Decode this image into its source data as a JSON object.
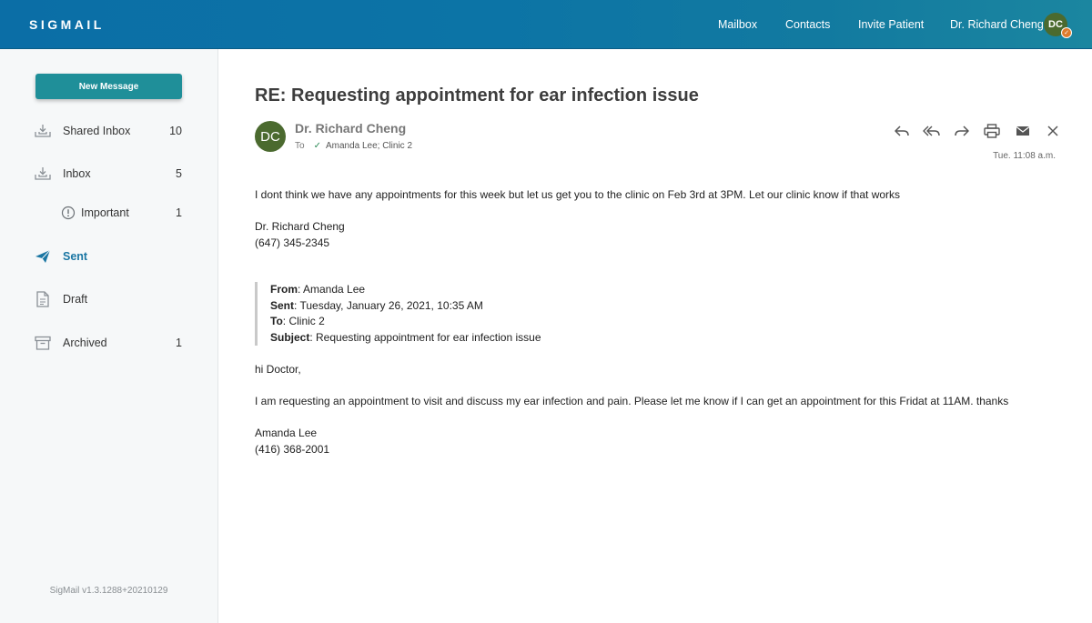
{
  "app": {
    "logo": "SIGMAIL",
    "nav": {
      "mailbox": "Mailbox",
      "contacts": "Contacts",
      "invite": "Invite Patient",
      "user": "Dr. Richard Cheng"
    },
    "avatar_initials": "DC",
    "brand_color": "#0c74a6",
    "accent_color": "#1f8f99"
  },
  "sidebar": {
    "new_message": "New Message",
    "items": [
      {
        "label": "Shared Inbox",
        "count": "10",
        "icon": "inbox-download-icon"
      },
      {
        "label": "Inbox",
        "count": "5",
        "icon": "inbox-download-icon"
      },
      {
        "label": "Important",
        "count": "1",
        "icon": "important-icon"
      },
      {
        "label": "Sent",
        "count": "",
        "icon": "send-icon"
      },
      {
        "label": "Draft",
        "count": "",
        "icon": "document-icon"
      },
      {
        "label": "Archived",
        "count": "1",
        "icon": "archive-icon"
      }
    ],
    "version": "SigMail v1.3.1288+20210129"
  },
  "message": {
    "subject": "RE: Requesting appointment for ear infection issue",
    "from_initials": "DC",
    "from_name": "Dr. Richard Cheng",
    "to_label": "To",
    "to_recipients": "Amanda Lee; Clinic 2",
    "date": "Tue. 11:08 a.m.",
    "body": "I dont think we have any appointments for this week but let us get you to the clinic on Feb 3rd at 3PM. Let our clinic know if that works",
    "signature_name": "Dr. Richard Cheng",
    "signature_phone": "(647) 345-2345",
    "quote": {
      "from_label": "From",
      "from_value": ": Amanda Lee",
      "sent_label": "Sent",
      "sent_value": ": Tuesday, January 26, 2021, 10:35 AM",
      "to_label": "To",
      "to_value": ": Clinic 2",
      "subject_label": "Subject",
      "subject_value": ": Requesting appointment for ear infection issue"
    },
    "original_greeting": "hi Doctor,",
    "original_body": "I am requesting an appointment to visit and discuss my ear infection and pain. Please let me know if I can get an appointment for this Fridat at 11AM. thanks",
    "original_name": "Amanda Lee",
    "original_phone": "(416) 368-2001"
  }
}
